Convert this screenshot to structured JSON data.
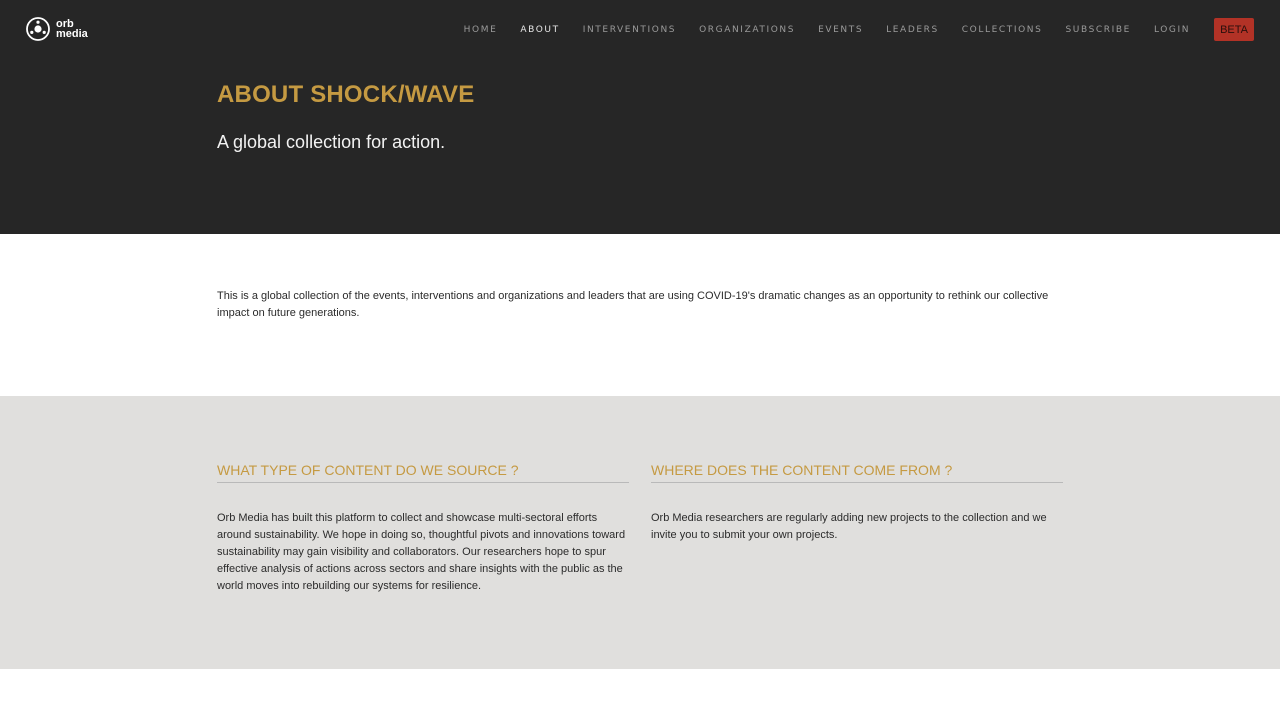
{
  "brand": {
    "name_line1": "orb",
    "name_line2": "media"
  },
  "nav": {
    "items": [
      {
        "label": "HOME",
        "active": false
      },
      {
        "label": "ABOUT",
        "active": true
      },
      {
        "label": "INTERVENTIONS",
        "active": false
      },
      {
        "label": "ORGANIZATIONS",
        "active": false
      },
      {
        "label": "EVENTS",
        "active": false
      },
      {
        "label": "LEADERS",
        "active": false
      },
      {
        "label": "COLLECTIONS",
        "active": false
      },
      {
        "label": "SUBSCRIBE",
        "active": false
      },
      {
        "label": "LOGIN",
        "active": false
      }
    ],
    "badge": "BETA"
  },
  "hero": {
    "title": "ABOUT SHOCK/WAVE",
    "subtitle": "A global collection for action."
  },
  "intro": {
    "text": "This is a global collection of the events, interventions and organizations and leaders that are using COVID-19's dramatic changes as an opportunity to rethink our collective impact on future generations."
  },
  "sections": {
    "content_type": {
      "heading": "WHAT TYPE OF CONTENT DO WE SOURCE ?",
      "body": "Orb Media has built this platform to collect and showcase multi-sectoral efforts around sustainability. We hope in doing so, thoughtful pivots and innovations toward sustainability may gain visibility and collaborators. Our researchers hope to spur effective analysis of actions across sectors and share insights with the public as the world moves into rebuilding our systems for resilience."
    },
    "content_source": {
      "heading": "WHERE DOES THE CONTENT COME FROM ?",
      "body": "Orb Media researchers are regularly adding new projects to the collection and we invite you to submit your own projects."
    }
  },
  "colors": {
    "accent": "#c59a42",
    "hero_bg": "#262626",
    "section_bg": "#e0dfdd",
    "badge_bg": "#b23226"
  },
  "icons": {
    "logo": "orb-logo-icon"
  }
}
